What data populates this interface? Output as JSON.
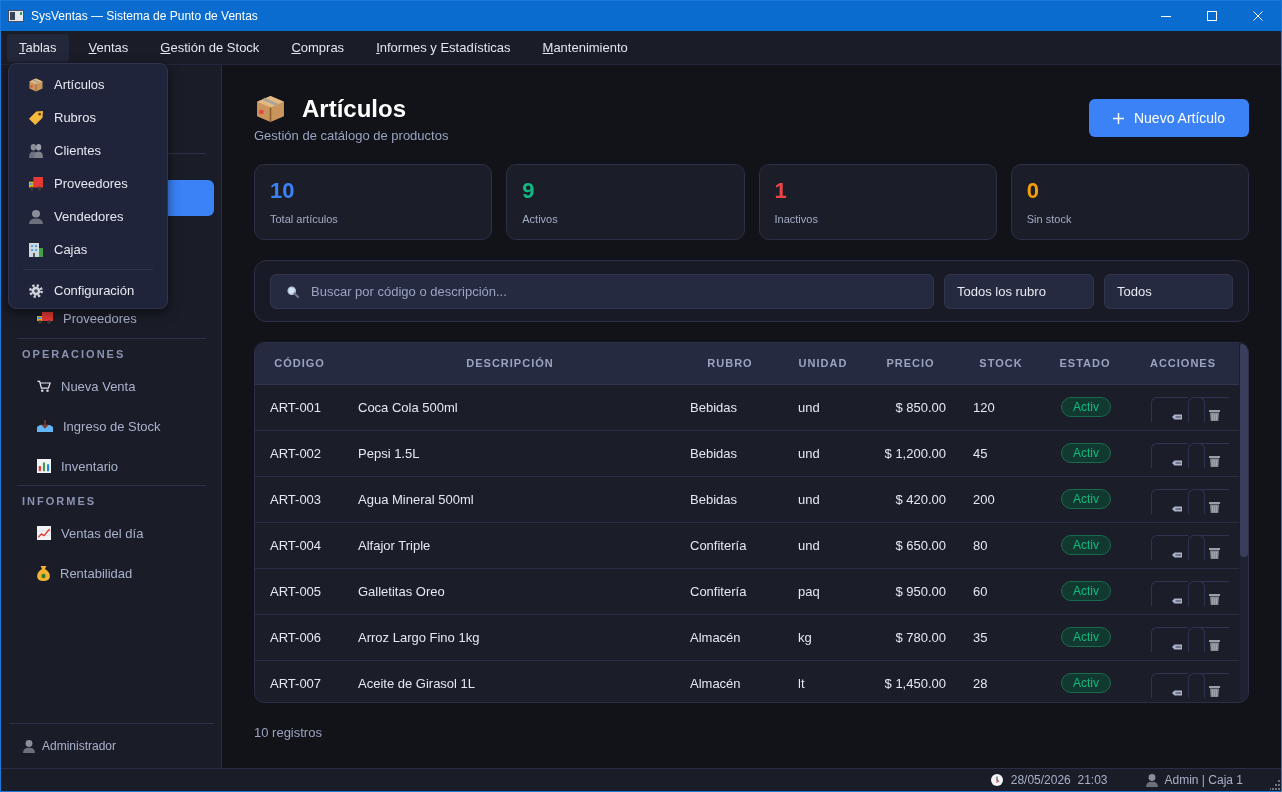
{
  "window": {
    "title": "SysVentas — Sistema de Punto de Ventas"
  },
  "menubar": [
    {
      "label": "Tablas",
      "selected": true
    },
    {
      "label": "Ventas",
      "selected": false
    },
    {
      "label": "Gestión de Stock",
      "selected": false
    },
    {
      "label": "Compras",
      "selected": false
    },
    {
      "label": "Informes y Estadísticas",
      "selected": false
    },
    {
      "label": "Mantenimiento",
      "selected": false
    }
  ],
  "dropdown": {
    "items": [
      {
        "kind": "item",
        "label": "Artículos"
      },
      {
        "kind": "item",
        "label": "Rubros"
      },
      {
        "kind": "item",
        "label": "Clientes"
      },
      {
        "kind": "item",
        "label": "Proveedores"
      },
      {
        "kind": "item",
        "label": "Vendedores"
      },
      {
        "kind": "item",
        "label": "Cajas"
      },
      {
        "kind": "separator"
      },
      {
        "kind": "item",
        "label": "Configuración"
      }
    ]
  },
  "sidebar": {
    "sections": [
      {
        "items": [
          {
            "selected": true
          },
          {
            "label": "Proveedores",
            "selected": false
          }
        ]
      },
      {
        "title": "OPERACIONES",
        "items": [
          {
            "label": "Nueva Venta",
            "selected": false
          },
          {
            "label": "Ingreso de Stock",
            "selected": false
          },
          {
            "label": "Inventario",
            "selected": false
          }
        ]
      },
      {
        "title": "INFORMES",
        "items": [
          {
            "label": "Ventas del día",
            "selected": false
          },
          {
            "label": "Rentabilidad",
            "selected": false
          }
        ]
      }
    ],
    "user": "Administrador"
  },
  "page": {
    "title": "Artículos",
    "subtitle": "Gestión de catálogo de productos",
    "new_button": "Nuevo Artículo"
  },
  "stats": [
    {
      "value": "10",
      "label": "Total artículos",
      "color": "#3b82f6"
    },
    {
      "value": "9",
      "label": "Activos",
      "color": "#10b981"
    },
    {
      "value": "1",
      "label": "Inactivos",
      "color": "#ef4444"
    },
    {
      "value": "0",
      "label": "Sin stock",
      "color": "#f59e0b"
    }
  ],
  "filters": {
    "search": {
      "placeholder": "Buscar por código o descripción..."
    },
    "category": "Todos los rubro",
    "status": "Todos"
  },
  "table": {
    "columns": [
      "CÓDIGO",
      "DESCRIPCIÓN",
      "RUBRO",
      "UNIDAD",
      "PRECIO",
      "STOCK",
      "ESTADO",
      "ACCIONES"
    ],
    "rows": [
      {
        "code": "ART-001",
        "description": "Coca Cola 500ml",
        "category": "Bebidas",
        "unit": "und",
        "price": "$ 850.00",
        "stock": "120",
        "status": "Activ",
        "active": true
      },
      {
        "code": "ART-002",
        "description": "Pepsi 1.5L",
        "category": "Bebidas",
        "unit": "und",
        "price": "$ 1,200.00",
        "stock": "45",
        "status": "Activ",
        "active": true
      },
      {
        "code": "ART-003",
        "description": "Agua Mineral 500ml",
        "category": "Bebidas",
        "unit": "und",
        "price": "$ 420.00",
        "stock": "200",
        "status": "Activ",
        "active": true
      },
      {
        "code": "ART-004",
        "description": "Alfajor Triple",
        "category": "Confitería",
        "unit": "und",
        "price": "$ 650.00",
        "stock": "80",
        "status": "Activ",
        "active": true
      },
      {
        "code": "ART-005",
        "description": "Galletitas Oreo",
        "category": "Confitería",
        "unit": "paq",
        "price": "$ 950.00",
        "stock": "60",
        "status": "Activ",
        "active": true
      },
      {
        "code": "ART-006",
        "description": "Arroz Largo Fino 1kg",
        "category": "Almacén",
        "unit": "kg",
        "price": "$ 780.00",
        "stock": "35",
        "status": "Activ",
        "active": true
      },
      {
        "code": "ART-007",
        "description": "Aceite de Girasol 1L",
        "category": "Almacén",
        "unit": "lt",
        "price": "$ 1,450.00",
        "stock": "28",
        "status": "Activ",
        "active": true
      }
    ]
  },
  "footer": {
    "count": "10 registros"
  },
  "status_bar": {
    "datetime": "28/05/2026  21:03",
    "session": "Admin | Caja 1"
  }
}
